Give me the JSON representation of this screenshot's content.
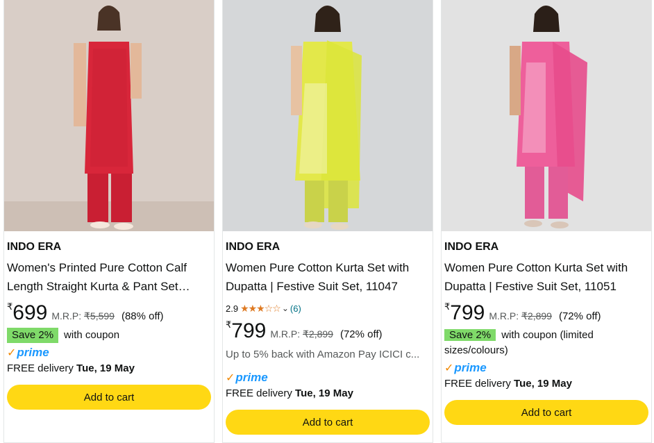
{
  "products": [
    {
      "brand": "INDO ERA",
      "title": "Women's Printed Pure Cotton Calf Length Straight Kurta & Pant Set…",
      "price_symbol": "₹",
      "price": "699",
      "mrp_label": "M.R.P:",
      "mrp": "₹5,599",
      "discount": "(88% off)",
      "coupon_badge": "Save 2%",
      "coupon_text": "with coupon",
      "prime_label": "prime",
      "delivery_prefix": "FREE delivery",
      "delivery_date": "Tue, 19 May",
      "cart_label": "Add to cart",
      "image_colors": {
        "bg": "#d9cec7",
        "dress": "#d8263a"
      }
    },
    {
      "brand": "INDO ERA",
      "title": "Women Pure Cotton Kurta Set with Dupatta | Festive Suit Set, 11047",
      "rating_value": "2.9",
      "rating_stars": 3,
      "rating_count": "(6)",
      "price_symbol": "₹",
      "price": "799",
      "mrp_label": "M.R.P:",
      "mrp": "₹2,899",
      "discount": "(72% off)",
      "cashback": "Up to 5% back with Amazon Pay ICICI c...",
      "prime_label": "prime",
      "delivery_prefix": "FREE delivery",
      "delivery_date": "Tue, 19 May",
      "cart_label": "Add to cart",
      "image_colors": {
        "bg": "#d5d7d9",
        "dress": "#e3e84a"
      }
    },
    {
      "brand": "INDO ERA",
      "title": "Women Pure Cotton Kurta Set with Dupatta | Festive Suit Set, 11051",
      "price_symbol": "₹",
      "price": "799",
      "mrp_label": "M.R.P:",
      "mrp": "₹2,899",
      "discount": "(72% off)",
      "coupon_badge": "Save 2%",
      "coupon_text": "with coupon (limited sizes/colours)",
      "prime_label": "prime",
      "delivery_prefix": "FREE delivery",
      "delivery_date": "Tue, 19 May",
      "cart_label": "Add to cart",
      "image_colors": {
        "bg": "#e2e2e2",
        "dress": "#ee5f9b"
      }
    }
  ]
}
